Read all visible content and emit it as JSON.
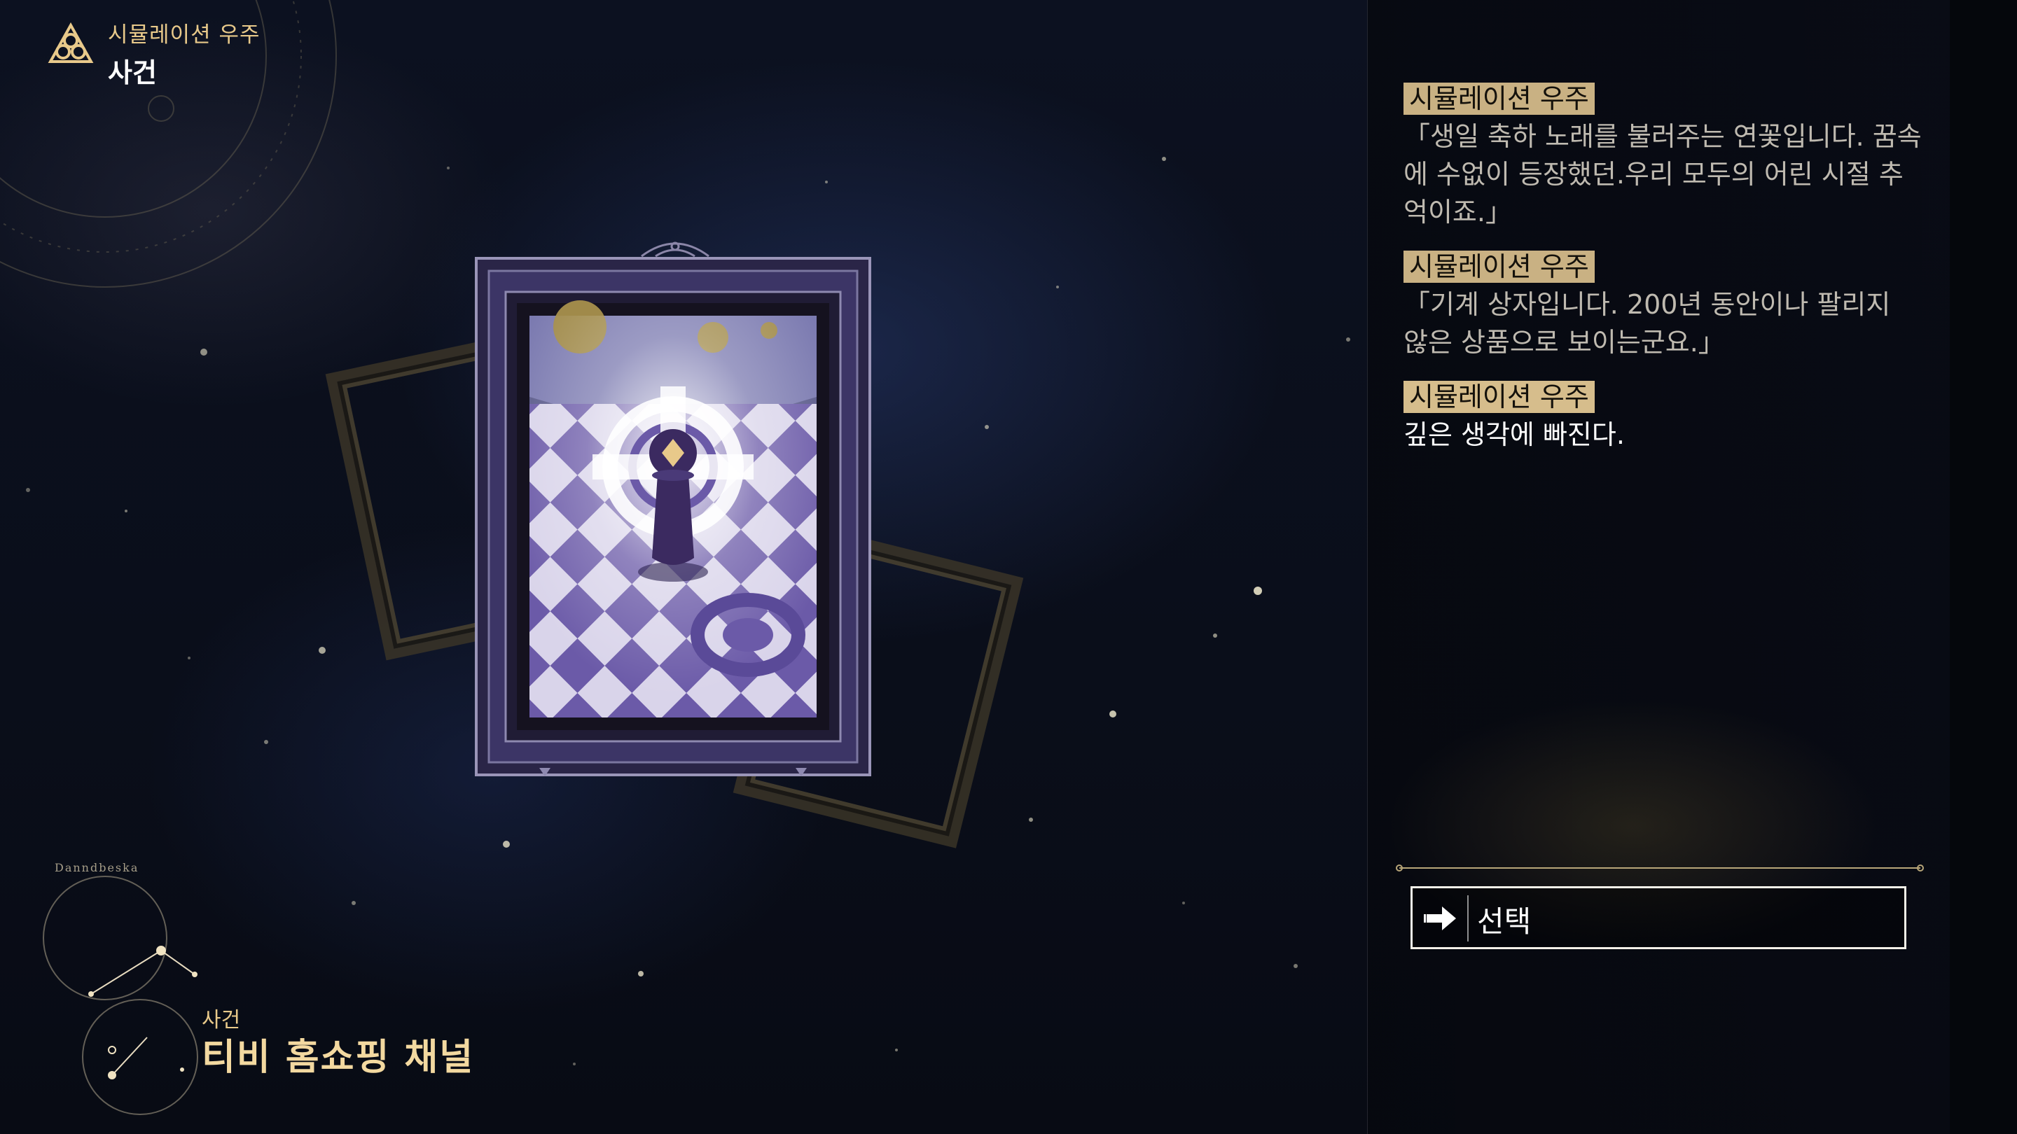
{
  "hud": {
    "subtitle": "시뮬레이션 우주",
    "title": "사건"
  },
  "event": {
    "category": "사건",
    "name": "티비 홈쇼핑 채널",
    "constellation_label": "Danndbeska"
  },
  "dialog": [
    {
      "speaker": "시뮬레이션 우주",
      "text": "「생일 축하 노래를 불러주는 연꽃입니다. 꿈속에 수없이 등장했던.우리 모두의 어린 시절 추억이죠.」"
    },
    {
      "speaker": "시뮬레이션 우주",
      "text": "「기계 상자입니다. 200년 동안이나 팔리지 않은 상품으로 보이는군요.」"
    },
    {
      "speaker": "시뮬레이션 우주",
      "text": "깊은 생각에 빠진다."
    }
  ],
  "choices": [
    {
      "label": "선택",
      "icon": "arrow-right-icon"
    }
  ],
  "colors": {
    "accent_gold": "#e8c98a",
    "speaker_tag": "#c9b183",
    "card_purple": "#6b5aa8"
  }
}
